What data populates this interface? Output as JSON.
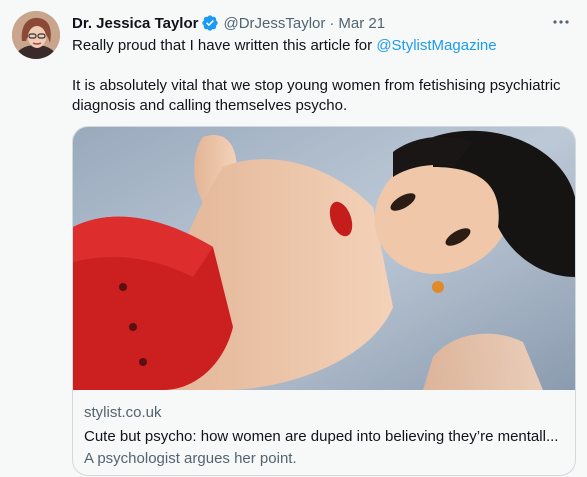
{
  "tweet": {
    "author_name": "Dr. Jessica Taylor",
    "handle": "@DrJessTaylor",
    "separator": "·",
    "date": "Mar 21",
    "text_line1_prefix": "Really proud that I have written this article for ",
    "mention": "@StylistMagazine",
    "text_paragraph2": "It is absolutely vital that we stop young women from fetishising psychiatric diagnosis and calling themselves psycho.",
    "avatar_icon": "profile-photo-icon",
    "verified_icon": "verified-badge-icon",
    "more_icon": "more-options-icon"
  },
  "card": {
    "domain": "stylist.co.uk",
    "title": "Cute but psycho: how women are duped into believing they’re mentall...",
    "description": "A psychologist argues her point.",
    "image_icon": "article-thumbnail-doll-photo"
  },
  "colors": {
    "accent": "#1d9bf0",
    "secondary_text": "#536471",
    "background": "#f7f9f9",
    "border": "#cfd9de"
  }
}
